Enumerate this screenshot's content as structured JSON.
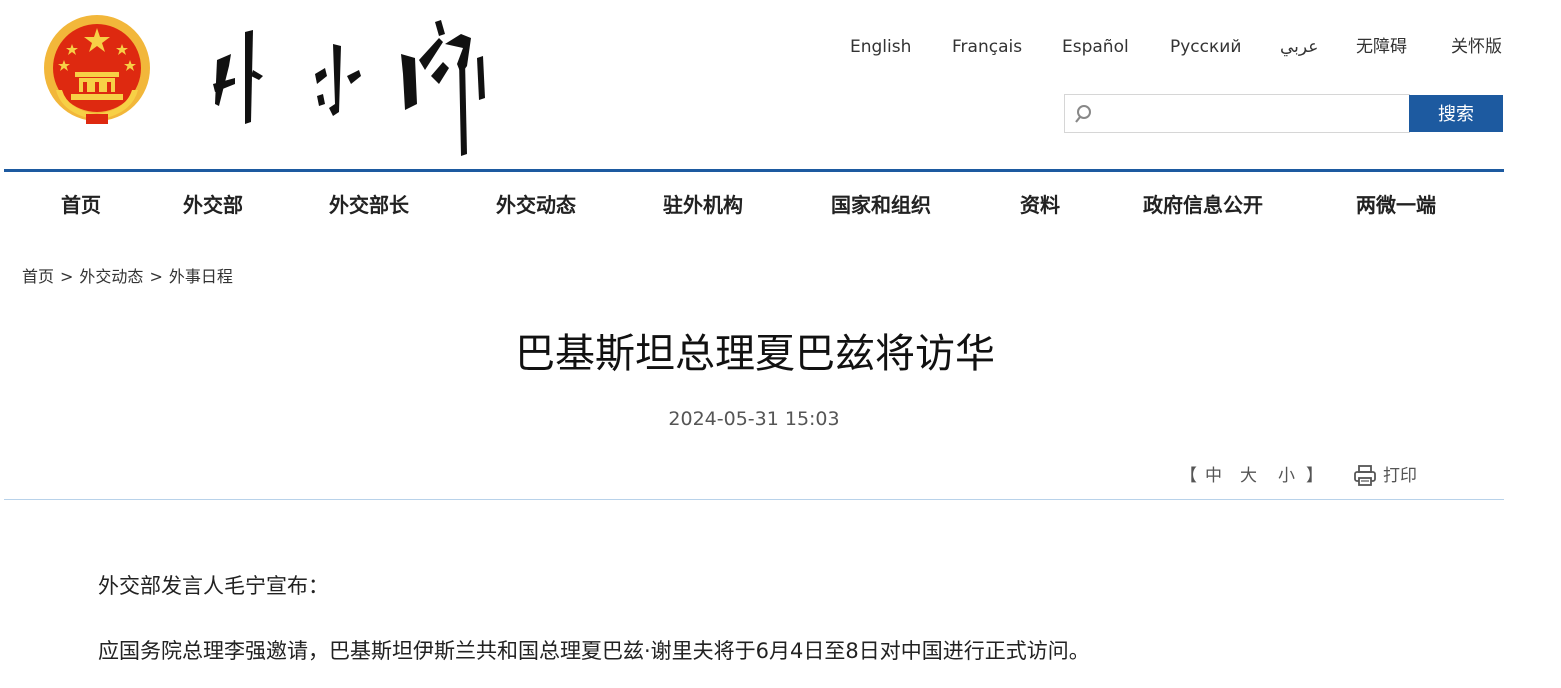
{
  "header": {
    "site_title": "外交部",
    "languages": [
      {
        "label": "English"
      },
      {
        "label": "Français"
      },
      {
        "label": "Español"
      },
      {
        "label": "Русский"
      },
      {
        "label": "عربي"
      },
      {
        "label": "无障碍"
      },
      {
        "label": "关怀版"
      }
    ],
    "search": {
      "placeholder": "",
      "value": "",
      "button_label": "搜索"
    }
  },
  "nav": {
    "items": [
      {
        "label": "首页"
      },
      {
        "label": "外交部"
      },
      {
        "label": "外交部长"
      },
      {
        "label": "外交动态"
      },
      {
        "label": "驻外机构"
      },
      {
        "label": "国家和组织"
      },
      {
        "label": "资料"
      },
      {
        "label": "政府信息公开"
      },
      {
        "label": "两微一端"
      }
    ]
  },
  "breadcrumb": {
    "items": [
      "首页",
      "外交动态",
      "外事日程"
    ],
    "separator": ">"
  },
  "article": {
    "title": "巴基斯坦总理夏巴兹将访华",
    "date": "2024-05-31 15:03",
    "font_controls": {
      "open": "【",
      "medium": "中",
      "large": "大",
      "small": "小",
      "close": "】"
    },
    "print_label": "打印",
    "paragraphs": [
      "外交部发言人毛宁宣布：",
      "应国务院总理李强邀请，巴基斯坦伊斯兰共和国总理夏巴兹·谢里夫将于6月4日至8日对中国进行正式访问。"
    ]
  },
  "colors": {
    "accent": "#1d5aa0",
    "emblem_red": "#de2910",
    "emblem_gold": "#f5c342",
    "divider": "#b8d2ea"
  }
}
